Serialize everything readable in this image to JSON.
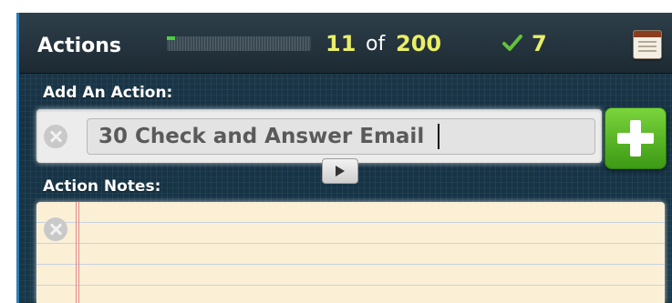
{
  "header": {
    "title": "Actions",
    "progress_fraction": 0.055,
    "count_current": "11",
    "count_separator": "of",
    "count_total": "200",
    "completed_count": "7",
    "icons": {
      "check": "check-icon",
      "notebook": "notebook-icon"
    },
    "colors": {
      "count": "#e9ef67",
      "check": "#63c23a",
      "progress_fill": "#4ccf3a"
    }
  },
  "add_action": {
    "label": "Add An Action:",
    "input_value": "30 Check and Answer Email",
    "clear_icon": "clear-icon",
    "add_button_icon": "plus-icon",
    "expand_button_icon": "play-icon",
    "colors": {
      "add_button": "#4fb21f"
    }
  },
  "notes": {
    "label": "Action Notes:",
    "value": "",
    "clear_icon": "clear-icon"
  }
}
